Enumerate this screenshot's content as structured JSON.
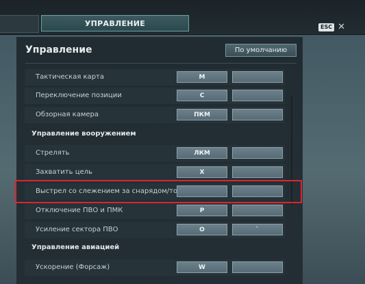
{
  "header": {
    "tab_label": "УПРАВЛЕНИЕ",
    "esc_label": "ESC",
    "close_glyph": "✕"
  },
  "panel": {
    "title": "Управление",
    "default_button": "По умолчанию"
  },
  "rows": [
    {
      "label": "Тактическая карта",
      "key1": "M",
      "key2": ""
    },
    {
      "label": "Переключение позиции",
      "key1": "C",
      "key2": ""
    },
    {
      "label": "Обзорная камера",
      "key1": "ПКМ",
      "key2": ""
    },
    {
      "label": "Стрелять",
      "key1": "ЛКМ",
      "key2": ""
    },
    {
      "label": "Захватить цель",
      "key1": "X",
      "key2": ""
    },
    {
      "label": "Выстрел со слежением за снарядом/торпедой",
      "key1": "",
      "key2": ""
    },
    {
      "label": "Отключение ПВО и ПМК",
      "key1": "P",
      "key2": ""
    },
    {
      "label": "Усиление сектора ПВО",
      "key1": "O",
      "key2": "`"
    },
    {
      "label": "Ускорение (Форсаж)",
      "key1": "W",
      "key2": ""
    }
  ],
  "sections": {
    "armament": "Управление вооружением",
    "aviation": "Управление авиацией"
  },
  "colors": {
    "highlight": "#e0232e",
    "tab_border": "#6aa3a4"
  }
}
